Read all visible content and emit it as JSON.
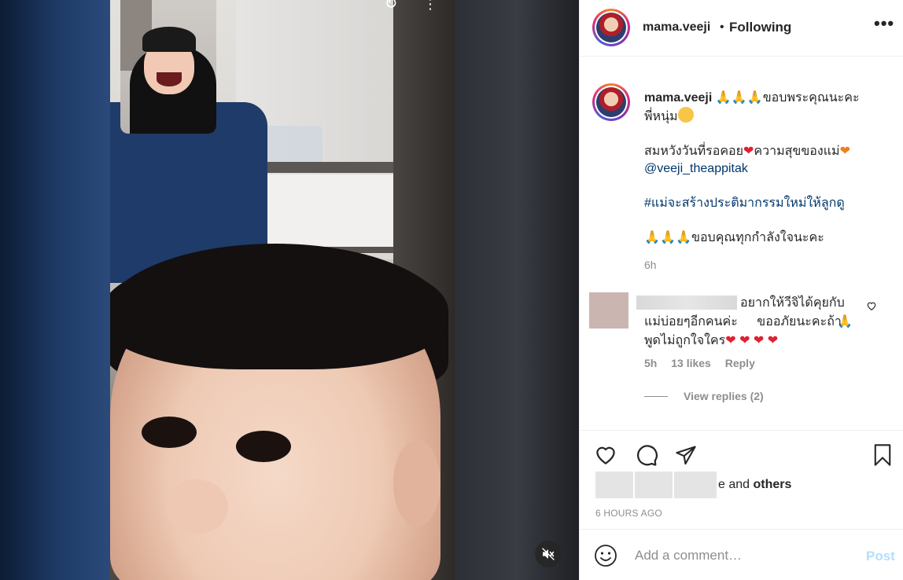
{
  "post": {
    "username": "mama.veeji",
    "dot": "•",
    "follow_status": "Following",
    "options_label": "•••"
  },
  "caption": {
    "username": "mama.veeji",
    "line1_text": "ขอบพระคุณนะคะ",
    "line2_text": "พี่หนุ่ม",
    "line3_text": "สมหวังวันที่รอคอย",
    "line3_text_b": "ความสุขของแม่",
    "mention": "@veeji_theappitak",
    "hashtag": "#แม่จะสร้างประติมากรรมใหม่ให้ลูกดู",
    "line6_text": "ขอบคุณทุกกำลังใจนะคะ",
    "time": "6h"
  },
  "comment": {
    "text_a": "อยากให้วีจิได้คุยกับแม่บ่อยๆอีกคนค่ะ",
    "text_b": "ขออภัยนะคะถ้าพูดไม่ถูกใจใคร",
    "time": "5h",
    "likes": "13 likes",
    "reply": "Reply",
    "view_replies": "View replies (2)"
  },
  "likes": {
    "suffix_e": "e and",
    "others": "others"
  },
  "timestamp": "6 HOURS AGO",
  "composer": {
    "placeholder": "Add a comment…",
    "post_label": "Post"
  },
  "glyphs": {
    "pray": "🙏",
    "heart": "❤",
    "cam_icon": "↻",
    "more_icon": "⋮"
  },
  "colors": {
    "link": "#00376b",
    "muted": "#8e8e8e",
    "post_disabled": "#b2dffc",
    "heart": "#e0212f"
  }
}
